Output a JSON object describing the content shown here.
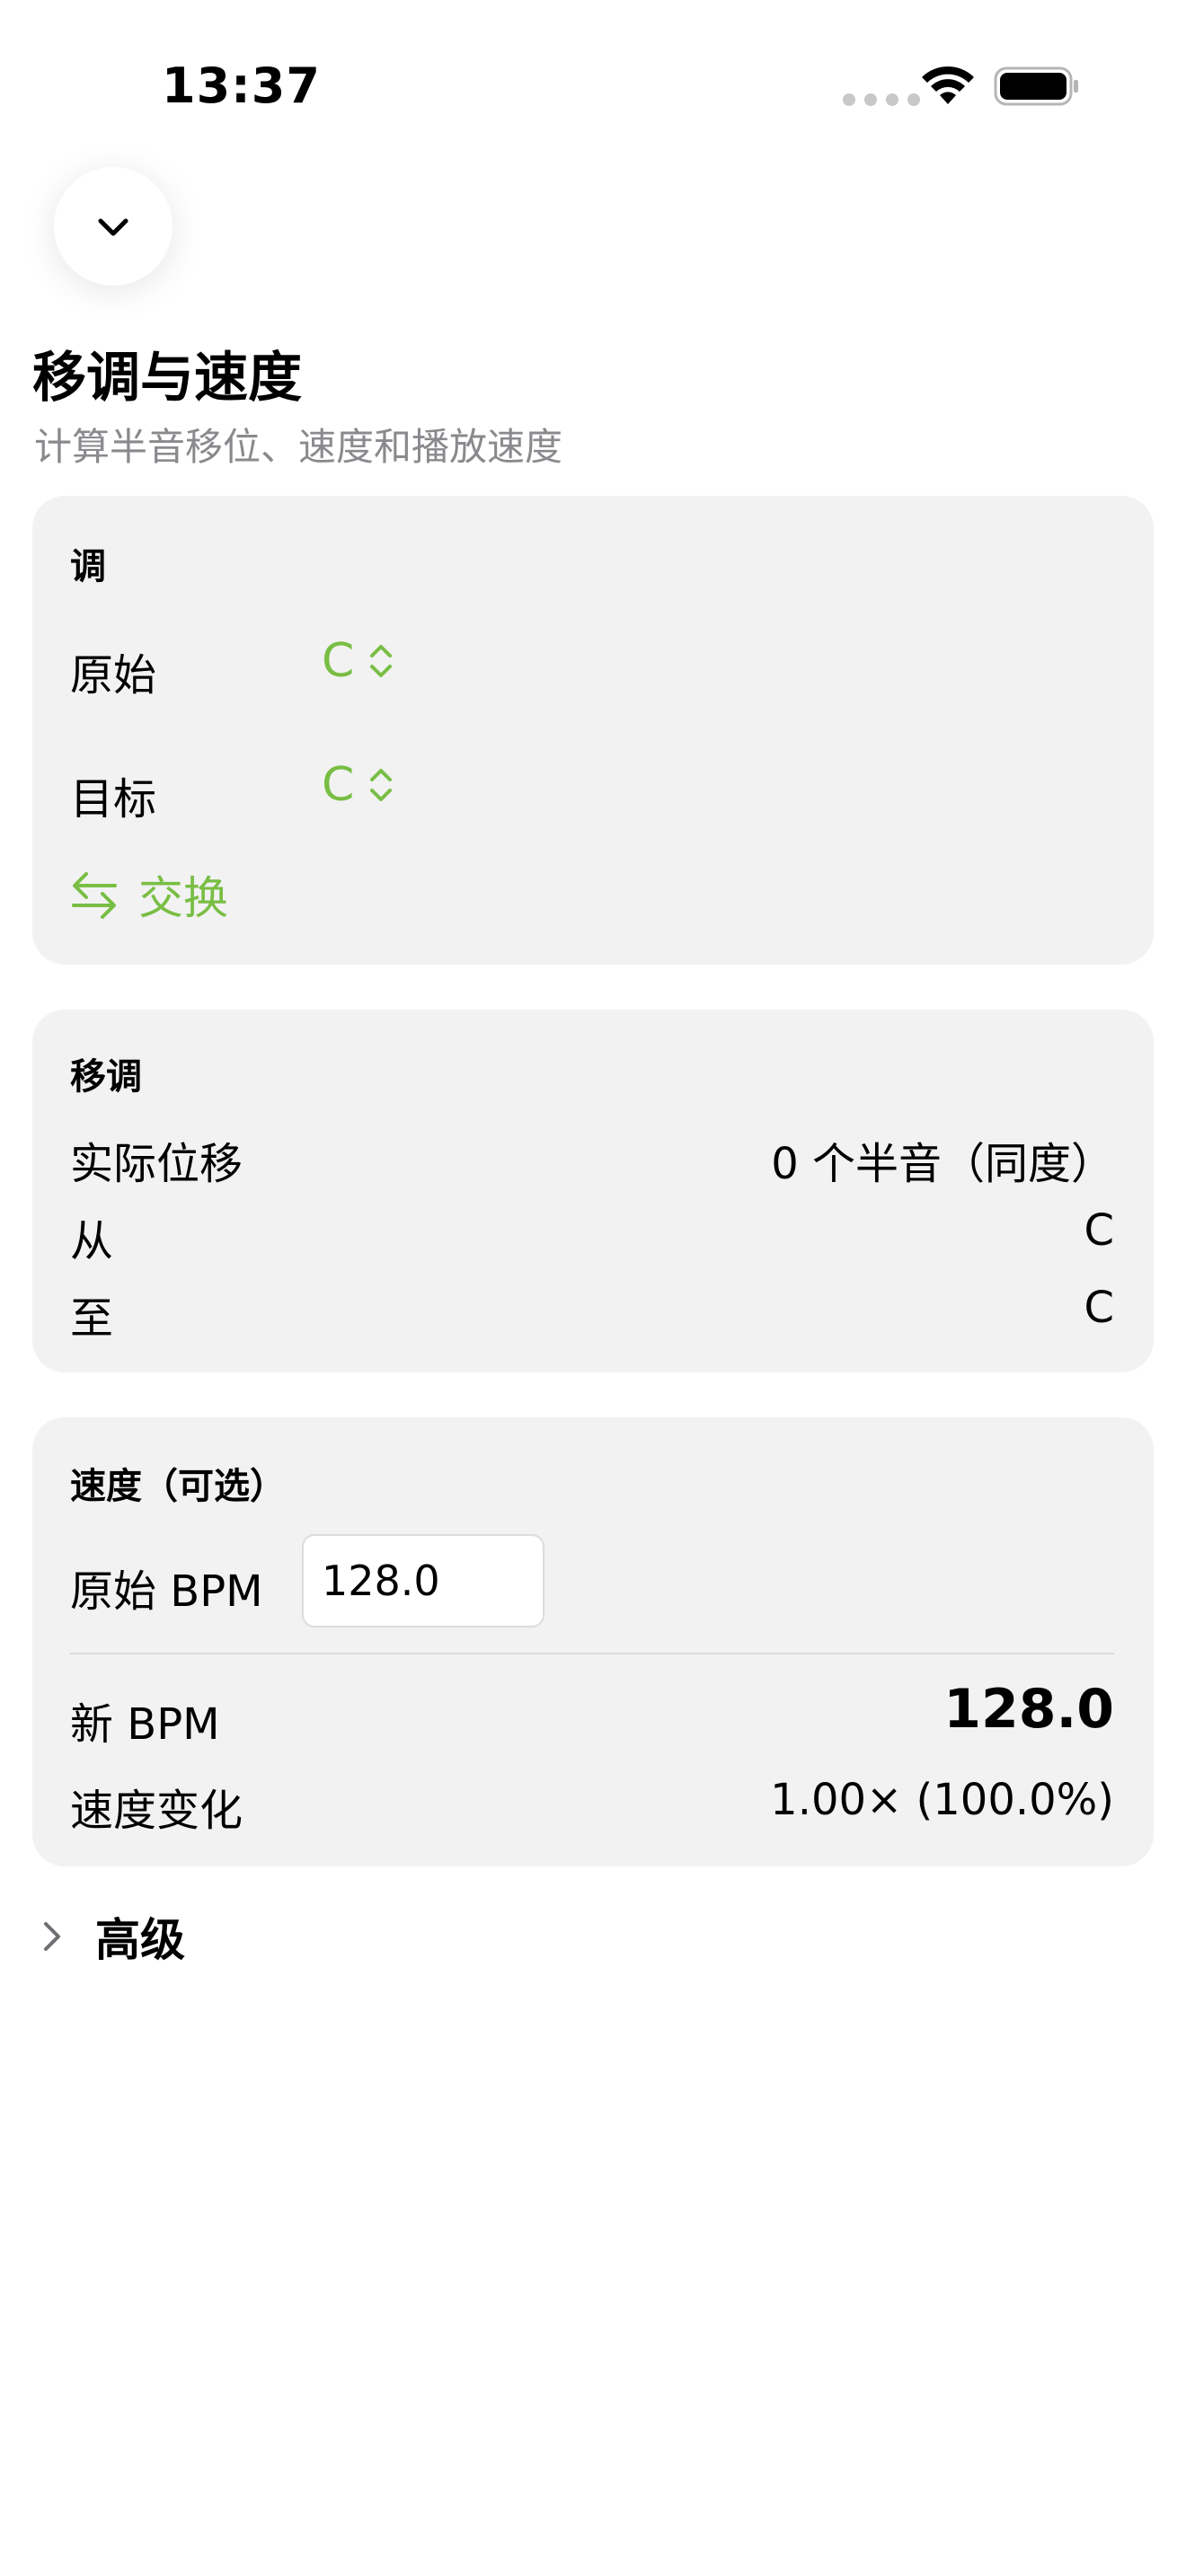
{
  "status_bar": {
    "time": "13:37",
    "icons": [
      "signal-dots-icon",
      "wifi-icon",
      "battery-icon"
    ]
  },
  "header": {
    "collapse_icon": "chevron-down-icon",
    "title": "移调与速度",
    "subtitle": "计算半音移位、速度和播放速度"
  },
  "key_section": {
    "heading": "调",
    "original_label": "原始",
    "original_value": "C",
    "target_label": "目标",
    "target_value": "C",
    "swap_label": "交换",
    "swap_icon": "swap-arrows-icon"
  },
  "transpose_section": {
    "heading": "移调",
    "rows": [
      {
        "label": "实际位移",
        "value": "0 个半音（同度）"
      },
      {
        "label": "从",
        "value": "C"
      },
      {
        "label": "至",
        "value": "C"
      }
    ]
  },
  "tempo_section": {
    "heading": "速度（可选）",
    "original_bpm_label": "原始 BPM",
    "original_bpm_value": "128.0",
    "new_bpm_label": "新 BPM",
    "new_bpm_value": "128.0",
    "speed_change_label": "速度变化",
    "speed_change_value": "1.00× (100.0%)"
  },
  "advanced": {
    "label": "高级",
    "icon": "chevron-right-icon"
  },
  "colors": {
    "accent": "#78be44",
    "card_background": "#f2f2f2",
    "secondary_text": "#8a8a8e"
  }
}
